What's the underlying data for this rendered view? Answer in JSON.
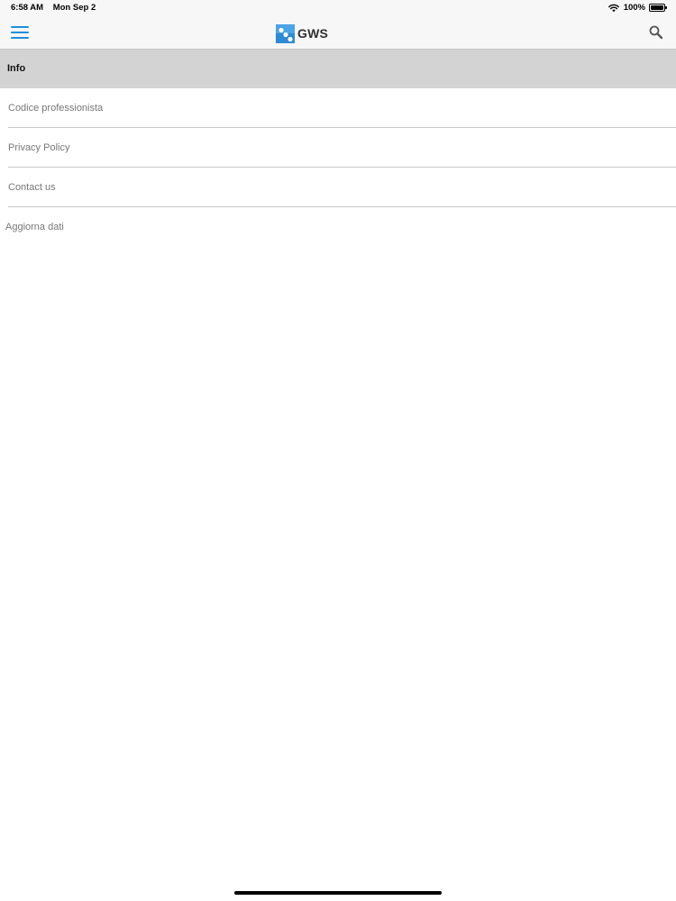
{
  "status_bar": {
    "time": "6:58 AM",
    "date": "Mon Sep 2",
    "battery": "100%",
    "icons": [
      "wifi-icon",
      "battery-icon"
    ]
  },
  "nav": {
    "menu_icon": "hamburger-menu-icon",
    "brand": "GWS",
    "logo_icon": "gws-logo-icon",
    "search_icon": "search-icon"
  },
  "section": {
    "title": "Info"
  },
  "menu": {
    "items": [
      {
        "label": "Codice professionista"
      },
      {
        "label": "Privacy Policy"
      },
      {
        "label": "Contact us"
      },
      {
        "label": "Aggiorna dati"
      }
    ]
  },
  "colors": {
    "accent": "#1a8fdc",
    "logo_blue": "#2d8ad4",
    "header_gray": "#d3d3d3",
    "bar_background": "#f7f7f8"
  }
}
